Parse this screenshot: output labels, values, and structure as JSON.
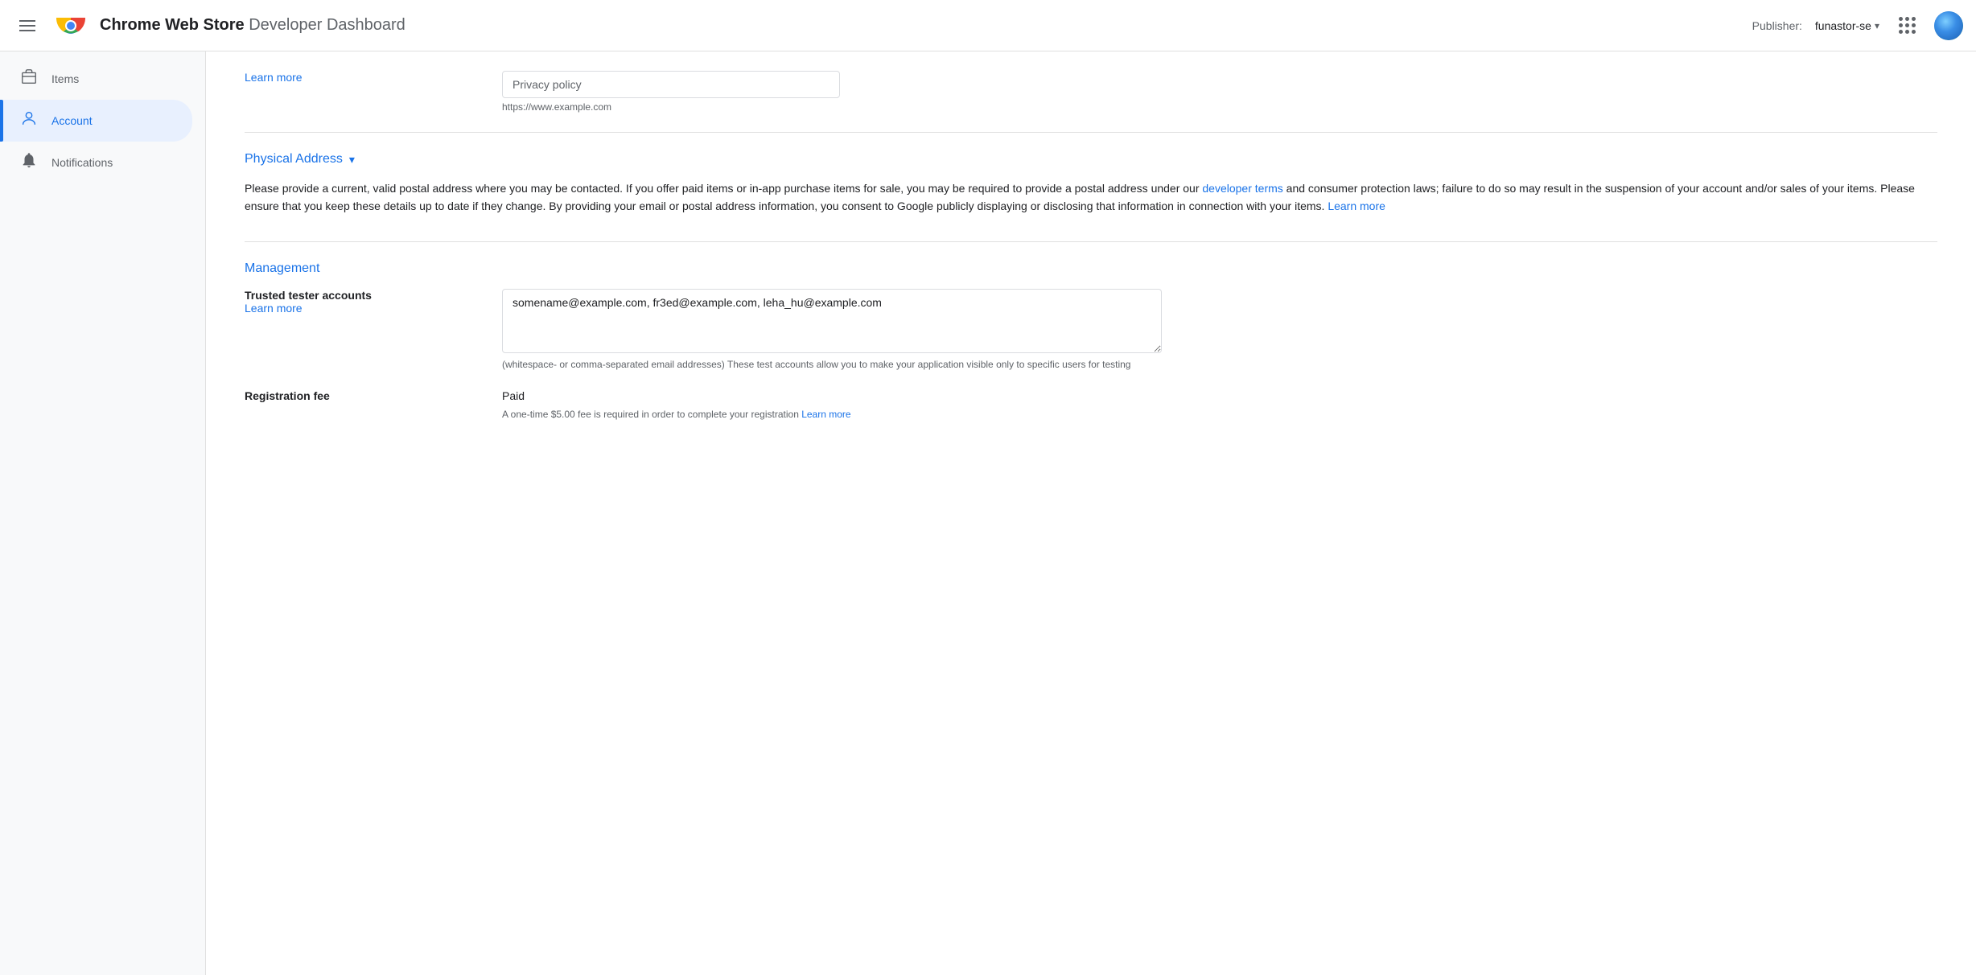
{
  "header": {
    "hamburger_label": "menu",
    "app_name": "Chrome Web Store",
    "dash_name": "Developer Dashboard",
    "publisher_label": "Publisher:",
    "publisher_name": "funastor-se",
    "grid_icon_label": "apps",
    "avatar_label": "user avatar"
  },
  "sidebar": {
    "items": [
      {
        "id": "items",
        "label": "Items",
        "icon": "📦",
        "active": false
      },
      {
        "id": "account",
        "label": "Account",
        "icon": "👤",
        "active": true
      },
      {
        "id": "notifications",
        "label": "Notifications",
        "icon": "🔔",
        "active": false
      }
    ]
  },
  "main": {
    "privacy_policy": {
      "label": "Privacy policy",
      "learn_more_text": "Learn more",
      "placeholder": "https://www.example.com"
    },
    "physical_address": {
      "section_title": "Physical Address",
      "expand_icon": "▾",
      "description_p1": "Please provide a current, valid postal address where you may be contacted. If you offer paid items or in-app purchase items for sale, you may be required to provide a postal address under our ",
      "developer_terms_link": "developer terms",
      "description_p2": " and consumer protection laws; failure to do so may result in the suspension of your account and/or sales of your items. Please ensure that you keep these details up to date if they change. By providing your email or postal address information, you consent to Google publicly displaying or disclosing that information in connection with your items. ",
      "learn_more_text": "Learn more"
    },
    "management": {
      "section_title": "Management",
      "trusted_tester": {
        "label": "Trusted tester accounts",
        "learn_more_text": "Learn more",
        "value": "somename@example.com, fr3ed@example.com, leha_hu@example.com",
        "hint": "(whitespace- or comma-separated email addresses) These test accounts allow you to make your application visible only to specific users for testing"
      },
      "registration_fee": {
        "label": "Registration fee",
        "value": "Paid",
        "hint_prefix": "A one-time $5.00 fee is required in order to complete your registration ",
        "learn_more_text": "Learn more"
      }
    }
  }
}
